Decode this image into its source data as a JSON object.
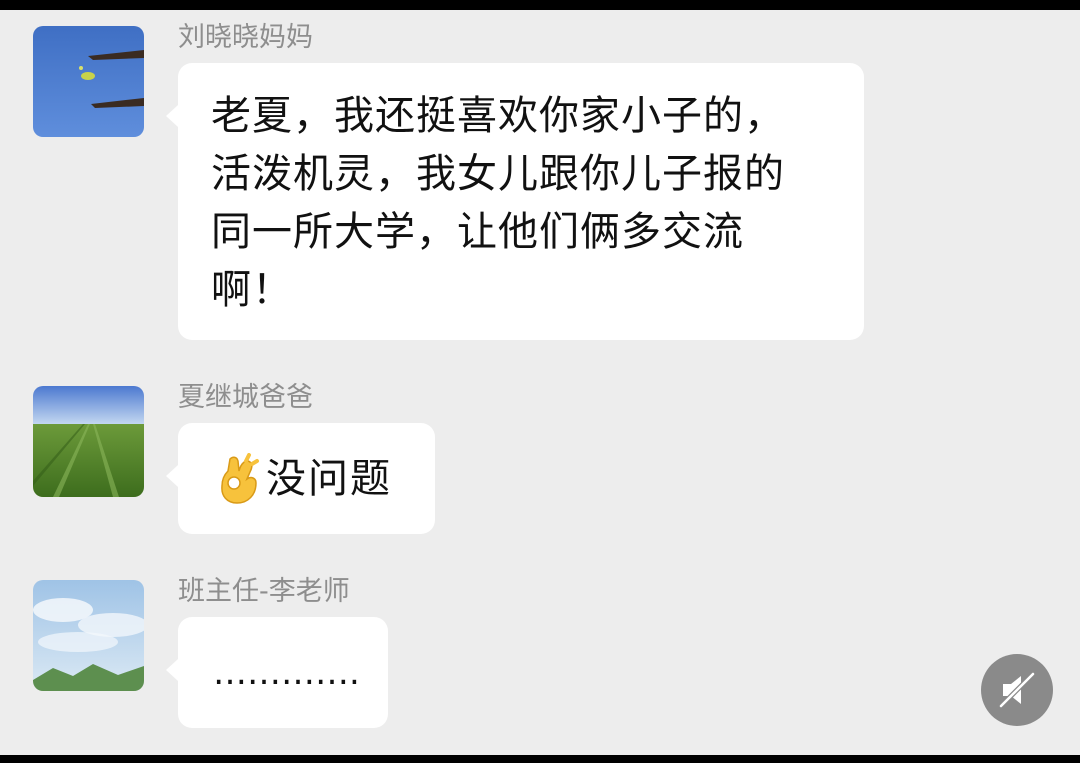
{
  "messages": [
    {
      "sender": "刘晓晓妈妈",
      "text": "老夏，我还挺喜欢你家小子的，\n活泼机灵，我女儿跟你儿子报的\n同一所大学，让他们俩多交流\n啊！",
      "avatar": "blue-sky-avatar"
    },
    {
      "sender": "夏继城爸爸",
      "emoji": "ok-hand-emoji",
      "text": "没问题",
      "avatar": "green-field-avatar"
    },
    {
      "sender": "班主任-李老师",
      "text": "………….",
      "avatar": "cloud-mountain-avatar"
    }
  ],
  "floating_button": {
    "icon": "mute-speaker-icon"
  },
  "colors": {
    "chat_background": "#ededed",
    "bubble": "#ffffff",
    "sender_name": "#8e8e8e",
    "float_button": "#8a8a8a"
  }
}
